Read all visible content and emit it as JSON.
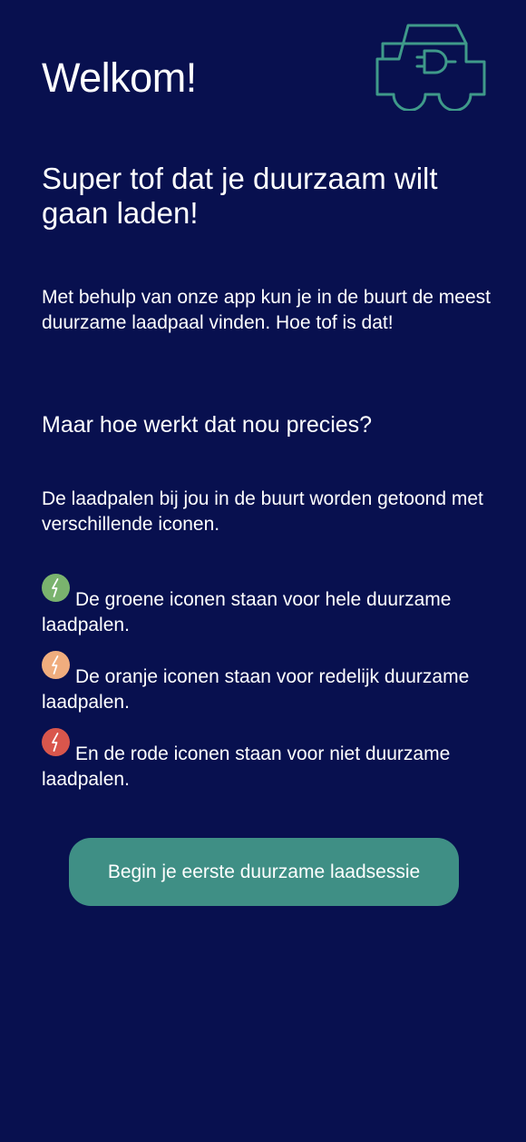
{
  "header": {
    "title": "Welkom!",
    "logo_icon": "electric-car-icon",
    "logo_color": "#3f9a8a"
  },
  "content": {
    "subtitle": "Super tof dat je duurzaam wilt gaan laden!",
    "intro": "Met behulp van onze app kun je in de buurt de meest duurzame laadpaal vinden. Hoe tof is dat!",
    "question": "Maar hoe werkt dat nou precies?",
    "explanation": "De laadpalen bij jou in de buurt worden getoond met verschillende iconen."
  },
  "legend": [
    {
      "icon": "lightning-icon",
      "color": "#7ab36e",
      "text": "De groene iconen staan voor hele duurzame laadpalen."
    },
    {
      "icon": "lightning-icon",
      "color": "#f0ad7e",
      "text": "De oranje iconen staan voor redelijk duurzame laadpalen."
    },
    {
      "icon": "lightning-icon",
      "color": "#d9564c",
      "text": "En de rode iconen staan voor niet duurzame laadpalen."
    }
  ],
  "cta": {
    "label": "Begin je eerste duurzame laadsessie",
    "color": "#3f8f85"
  },
  "theme": {
    "background": "#08104f",
    "text": "#ffffff"
  }
}
